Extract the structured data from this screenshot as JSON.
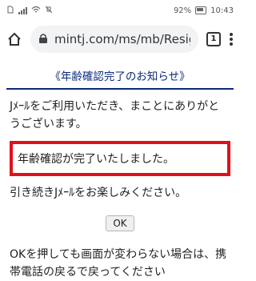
{
  "statusbar": {
    "battery": "92%",
    "time": "10:43"
  },
  "toolbar": {
    "url": "mintj.com/ms/mb/Resig",
    "tab_count": "1"
  },
  "page": {
    "header": "《年齢確認完了のお知らせ》",
    "intro": "Jﾒｰﾙをご利用いただき、まことにありがとうございます。",
    "highlight": "年齢確認が完了いたしました。",
    "continue_text": "引き続きJﾒｰﾙをお楽しみください。",
    "ok_label": "OK",
    "note": "OKを押しても画面が変わらない場合は、携帯電話の戻るで戻ってください"
  }
}
